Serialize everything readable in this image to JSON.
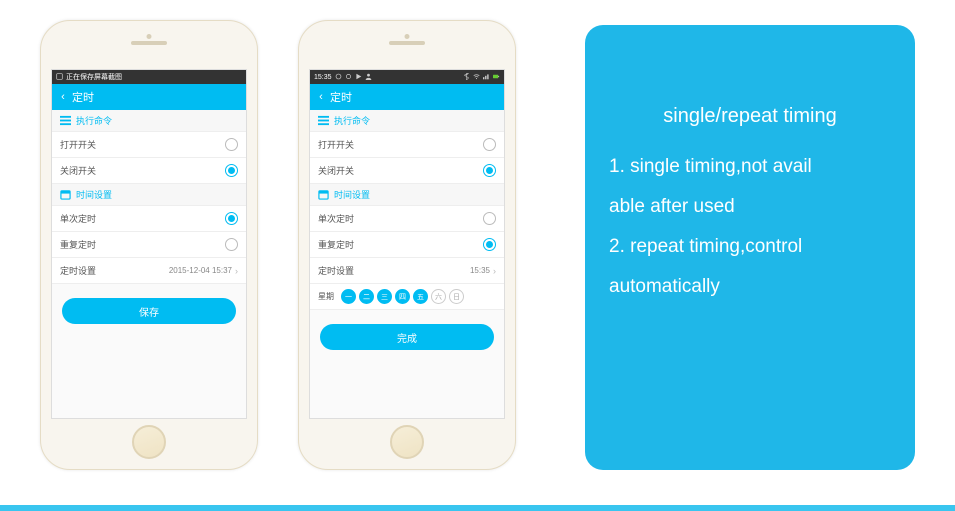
{
  "phone1": {
    "statusbar_text": "正在保存屏幕截图",
    "header_title": "定时",
    "section1": "执行命令",
    "row_power_on": "打开开关",
    "row_power_off": "关闭开关",
    "section2": "时间设置",
    "row_single": "单次定时",
    "row_repeat": "重复定时",
    "row_time_setting": "定时设置",
    "time_value": "2015-12-04 15:37",
    "submit": "保存"
  },
  "phone2": {
    "status_time": "15:35",
    "header_title": "定时",
    "section1": "执行命令",
    "row_power_on": "打开开关",
    "row_power_off": "关闭开关",
    "section2": "时间设置",
    "row_single": "单次定时",
    "row_repeat": "重复定时",
    "row_time_setting": "定时设置",
    "time_value": "15:35",
    "week_label": "星期",
    "days": [
      "一",
      "二",
      "三",
      "四",
      "五",
      "六",
      "日"
    ],
    "days_on": [
      true,
      true,
      true,
      true,
      true,
      false,
      false
    ],
    "submit": "完成"
  },
  "info": {
    "title": "single/repeat timing",
    "line1": "1. single timing,not avail",
    "line2": "able after used",
    "line3": "2. repeat timing,control",
    "line4": "automatically"
  }
}
